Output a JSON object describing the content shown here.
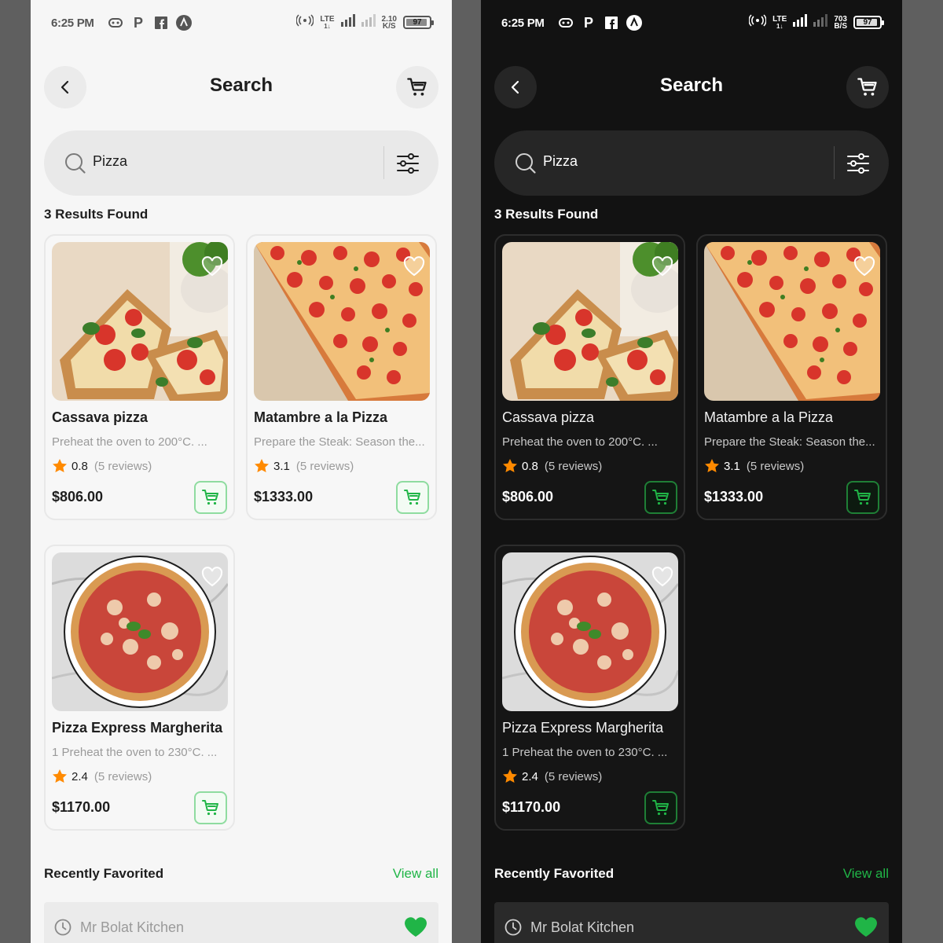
{
  "colors": {
    "accent": "#20b547",
    "star": "#ff8a00",
    "light_bg": "#f6f6f6",
    "dark_bg": "#121212"
  },
  "light": {
    "status": {
      "time": "6:25 PM",
      "lte": "LTE",
      "lte_sub": "1↓",
      "speed_top": "2.10",
      "speed_bottom": "K/S",
      "battery": "97"
    },
    "header": {
      "title": "Search"
    },
    "search": {
      "value": "Pizza"
    },
    "results_label": "3 Results Found",
    "recipes": [
      {
        "name": "Cassava pizza",
        "desc": "Preheat the oven to 200°C. ...",
        "rating": "0.8",
        "reviews": "(5 reviews)",
        "price": "$806.00"
      },
      {
        "name": "Matambre a la Pizza",
        "desc": "Prepare the Steak: Season the...",
        "rating": "3.1",
        "reviews": "(5 reviews)",
        "price": "$1333.00"
      },
      {
        "name": "Pizza Express Margherita",
        "desc": "1 Preheat the oven to 230°C. ...",
        "rating": "2.4",
        "reviews": "(5 reviews)",
        "price": "$1170.00"
      }
    ],
    "recent": {
      "title": "Recently Favorited",
      "view_all": "View all",
      "item": "Mr Bolat Kitchen"
    }
  },
  "dark": {
    "status": {
      "time": "6:25 PM",
      "lte": "LTE",
      "lte_sub": "1↓",
      "speed_top": "703",
      "speed_bottom": "B/S",
      "battery": "97"
    },
    "header": {
      "title": "Search"
    },
    "search": {
      "value": "Pizza"
    },
    "results_label": "3 Results Found",
    "recipes": [
      {
        "name": "Cassava pizza",
        "desc": "Preheat the oven to 200°C. ...",
        "rating": "0.8",
        "reviews": "(5 reviews)",
        "price": "$806.00"
      },
      {
        "name": "Matambre a la Pizza",
        "desc": "Prepare the Steak: Season the...",
        "rating": "3.1",
        "reviews": "(5 reviews)",
        "price": "$1333.00"
      },
      {
        "name": "Pizza Express Margherita",
        "desc": "1 Preheat the oven to 230°C. ...",
        "rating": "2.4",
        "reviews": "(5 reviews)",
        "price": "$1170.00"
      }
    ],
    "recent": {
      "title": "Recently Favorited",
      "view_all": "View all",
      "item": "Mr Bolat Kitchen"
    }
  }
}
